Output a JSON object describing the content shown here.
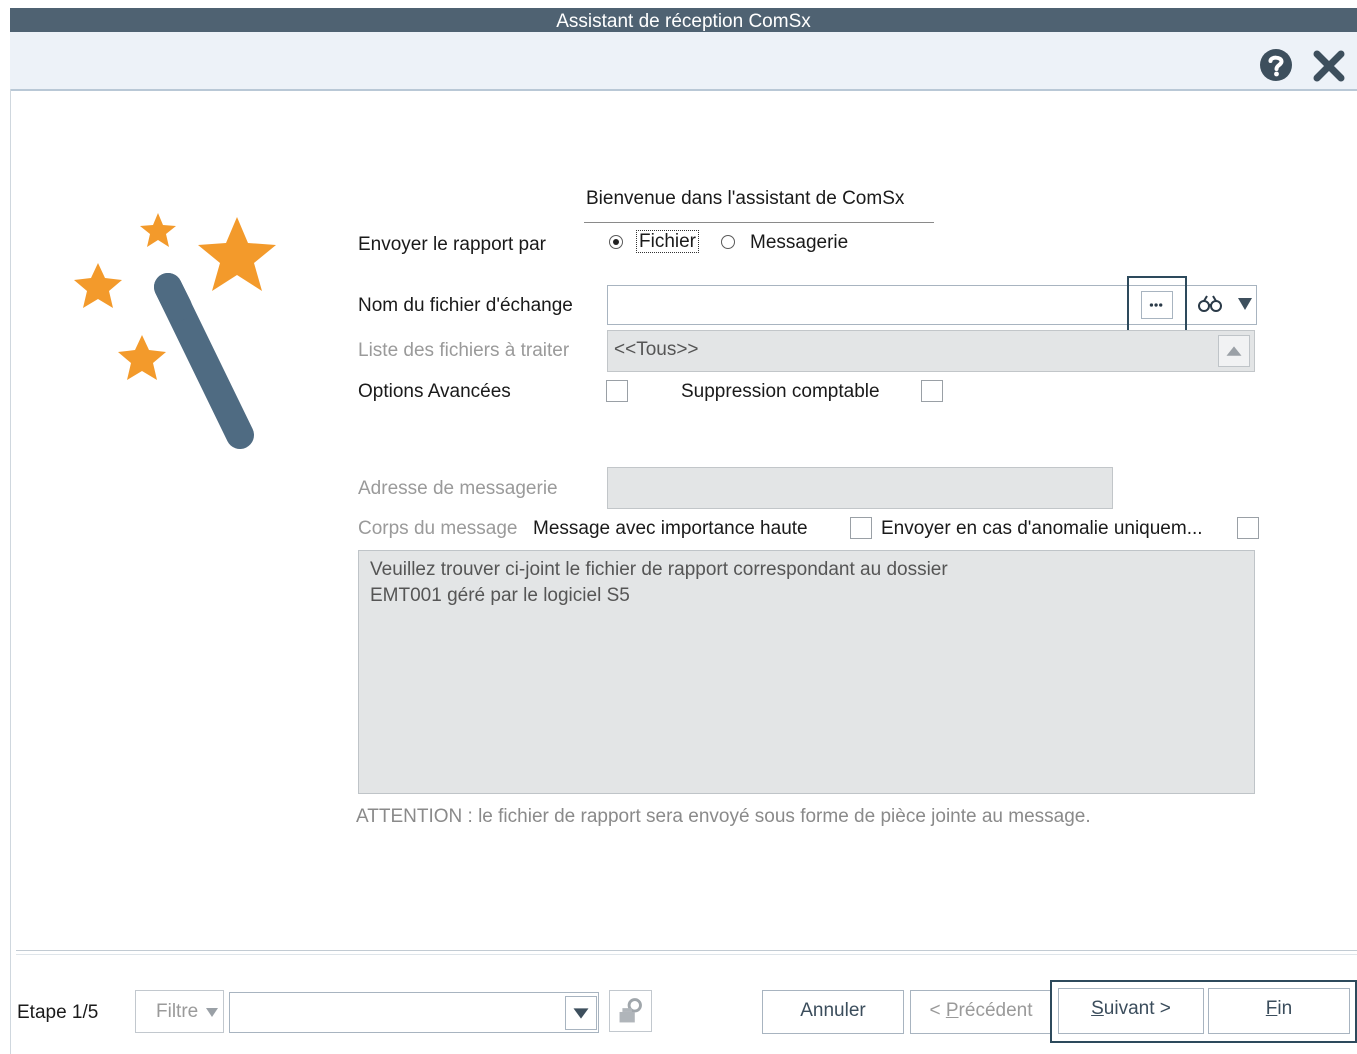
{
  "window": {
    "title": "Assistant de réception ComSx"
  },
  "toolbar": {
    "help_icon": "help-circle-icon",
    "close_icon": "close-x-icon"
  },
  "form": {
    "welcome": "Bienvenue dans l'assistant de ComSx",
    "send_report_label": "Envoyer le rapport par",
    "radio_file": "Fichier",
    "radio_mail": "Messagerie",
    "selected_mode": "Fichier",
    "exchange_file_label": "Nom du fichier d'échange",
    "exchange_file_value": "",
    "files_list_label": "Liste des fichiers à traiter",
    "files_list_value": "<<Tous>>",
    "advanced_options_label": "Options Avancées",
    "advanced_options_checked": false,
    "accounting_delete_label": "Suppression comptable",
    "accounting_delete_checked": false,
    "mail_address_label": "Adresse de messagerie",
    "mail_address_value": "",
    "message_body_label": "Corps du message",
    "high_importance_label": "Message avec importance haute",
    "high_importance_checked": false,
    "anomaly_only_label": "Envoyer en cas d'anomalie uniquem...",
    "anomaly_only_checked": false,
    "message_body_line1": "Veuillez trouver ci-joint le fichier de rapport correspondant au dossier",
    "message_body_line2": "EMT001 géré par le logiciel S5",
    "warning": "ATTENTION : le fichier de rapport sera envoyé sous forme de pièce jointe au message."
  },
  "footer": {
    "step": "Etape 1/5",
    "filter_label": "Filtre",
    "filter_value": "",
    "cancel": "Annuler",
    "previous_prefix": "< ",
    "previous_key": "P",
    "previous_rest": "récédent",
    "next_key": "S",
    "next_rest": "uivant >",
    "finish_key": "F",
    "finish_rest": "in"
  },
  "colors": {
    "titlebar": "#4f6272",
    "accent_star": "#f39a2b",
    "wand": "#4f6b82",
    "highlight_border": "#2d4a5c"
  }
}
